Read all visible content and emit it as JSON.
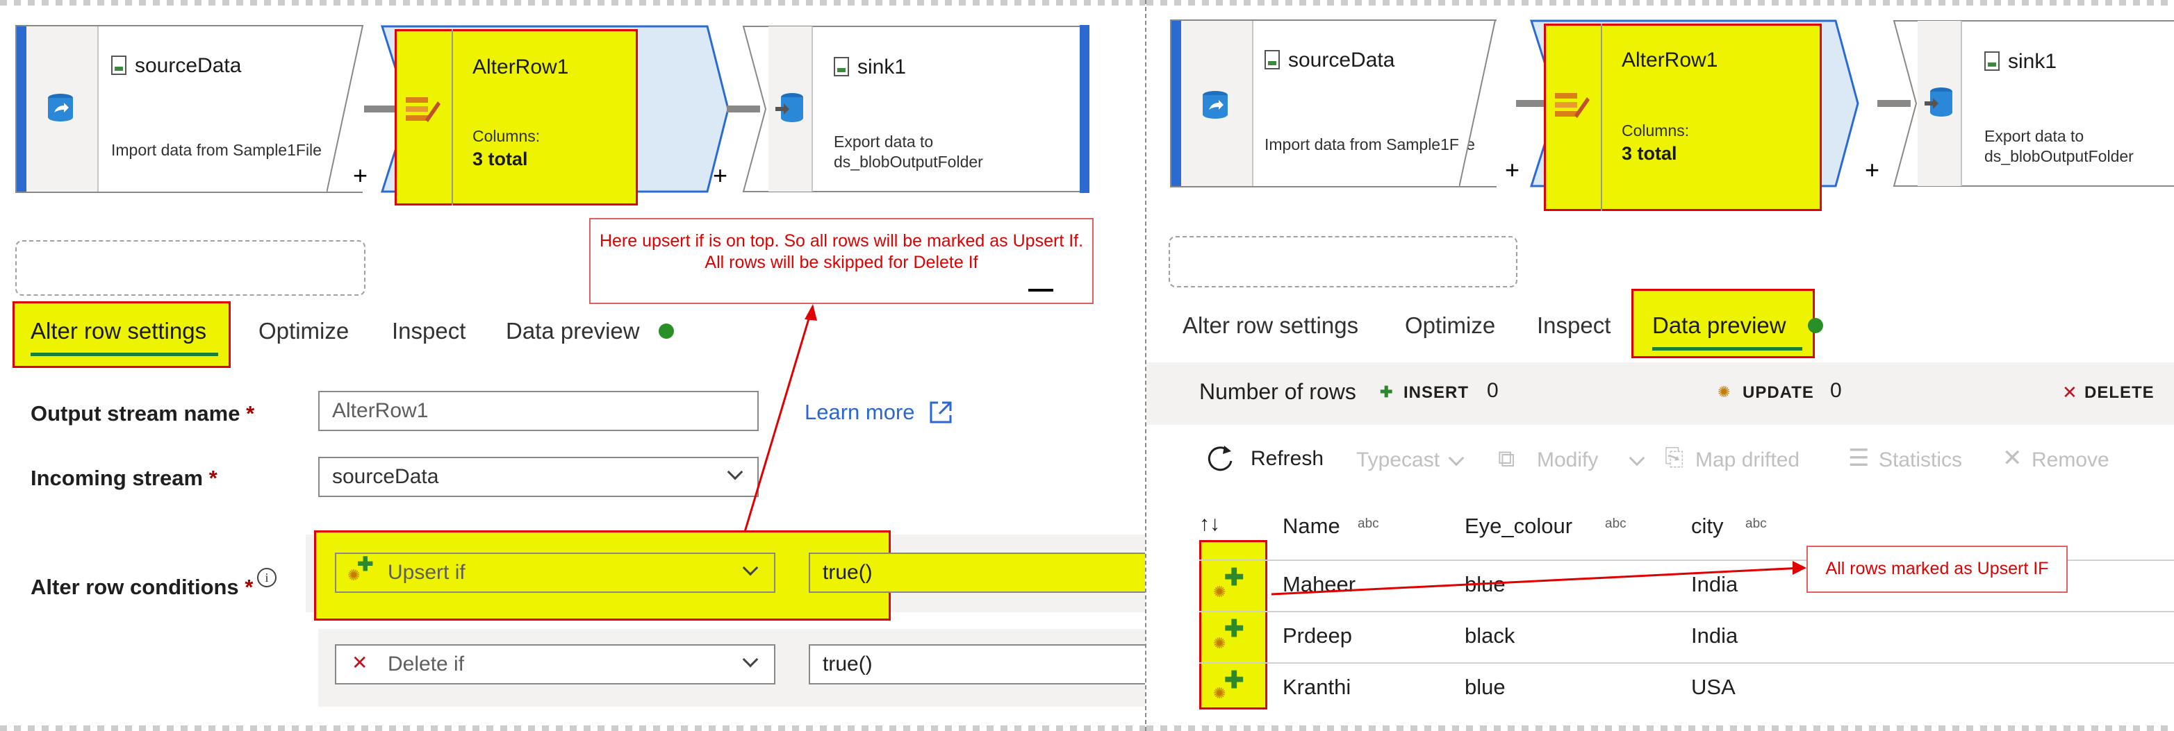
{
  "left": {
    "flow": {
      "source": {
        "title": "sourceData",
        "desc": "Import data from Sample1File"
      },
      "alter": {
        "title": "AlterRow1",
        "columns_label": "Columns:",
        "columns_value": "3 total"
      },
      "sink": {
        "title": "sink1",
        "desc_line1": "Export data to",
        "desc_line2": "ds_blobOutputFolder"
      },
      "plus": "+"
    },
    "callout": "Here upsert if is on top. So all rows will be marked as Upsert If. All rows will be skipped for Delete If",
    "tabs": [
      "Alter row settings",
      "Optimize",
      "Inspect",
      "Data preview"
    ],
    "form": {
      "output_label": "Output stream name",
      "output_value": "AlterRow1",
      "incoming_label": "Incoming stream",
      "incoming_value": "sourceData",
      "conditions_label": "Alter row conditions",
      "required": "*",
      "info_icon": "i",
      "learn_more": "Learn more",
      "cond1_type": "Upsert if",
      "cond1_expr": "true()",
      "cond2_type": "Delete if",
      "cond2_expr": "true()"
    }
  },
  "right": {
    "flow": {
      "source": {
        "title": "sourceData",
        "desc": "Import data from Sample1File"
      },
      "alter": {
        "title": "AlterRow1",
        "columns_label": "Columns:",
        "columns_value": "3 total"
      },
      "sink": {
        "title": "sink1",
        "desc_line1": "Export data to",
        "desc_line2": "ds_blobOutputFolder"
      },
      "plus": "+"
    },
    "tabs": [
      "Alter row settings",
      "Optimize",
      "Inspect",
      "Data preview"
    ],
    "stats": {
      "label": "Number of rows",
      "insert_label": "INSERT",
      "insert_value": "0",
      "update_label": "UPDATE",
      "update_value": "0",
      "delete_label": "DELETE"
    },
    "toolbar": {
      "refresh": "Refresh",
      "typecast": "Typecast",
      "modify": "Modify",
      "map_drifted": "Map drifted",
      "statistics": "Statistics",
      "remove": "Remove"
    },
    "table": {
      "sort_icon": "↑↓",
      "columns": [
        {
          "name": "Name",
          "type": "abc"
        },
        {
          "name": "Eye_colour",
          "type": "abc"
        },
        {
          "name": "city",
          "type": "abc"
        }
      ],
      "rows": [
        [
          "Maheer",
          "blue",
          "India"
        ],
        [
          "Prdeep",
          "black",
          "India"
        ],
        [
          "Kranthi",
          "blue",
          "USA"
        ]
      ]
    },
    "callout": "All rows marked as Upsert IF"
  },
  "colors": {
    "highlight": "#eef400",
    "annotation_red": "#e00000",
    "accent_blue": "#2b6bd1",
    "status_green": "#2a8f27"
  }
}
